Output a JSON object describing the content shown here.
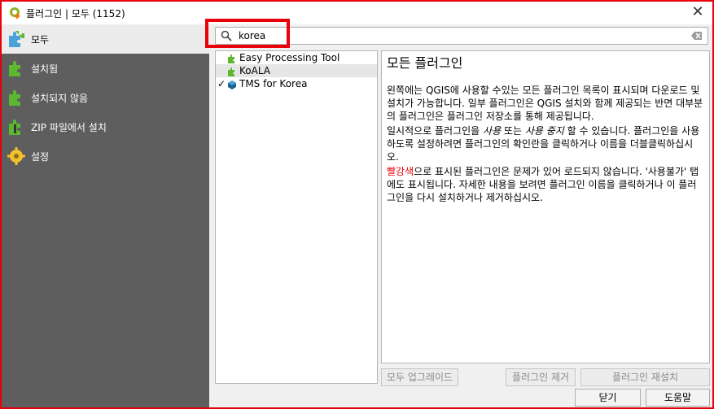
{
  "window": {
    "title": "플러그인 | 모두 (1152)",
    "close_symbol": "✕"
  },
  "sidebar": {
    "items": [
      {
        "label": "모두",
        "icon": "puzzle-all-icon"
      },
      {
        "label": "설치됨",
        "icon": "puzzle-installed-icon"
      },
      {
        "label": "설치되지 않음",
        "icon": "puzzle-not-installed-icon"
      },
      {
        "label": "ZIP 파일에서 설치",
        "icon": "zip-install-icon"
      },
      {
        "label": "설정",
        "icon": "settings-gear-icon"
      }
    ],
    "active_index": 0
  },
  "search": {
    "value": "korea"
  },
  "plugins": [
    {
      "name": "Easy Processing Tool",
      "checked": false,
      "icon": "puzzle-icon"
    },
    {
      "name": "KoALA",
      "checked": false,
      "icon": "puzzle-icon",
      "selected": true
    },
    {
      "name": "TMS for Korea",
      "checked": true,
      "icon": "plugin-3d-icon"
    }
  ],
  "details": {
    "title": "모든 플러그인",
    "p1": "왼쪽에는 QGIS에 사용할 수있는 모든 플러그인 목록이 표시되며 다운로드 및 설치가 가능합니다. 일부 플러그인은 QGIS 설치와 함께 제공되는 반면 대부분의 플러그인은 플러그인 저장소를 통해 제공됩니다.",
    "p2_a": "일시적으로 플러그인을 ",
    "p2_em1": "사용",
    "p2_b": " 또는 ",
    "p2_em2": "사용 중지",
    "p2_c": " 할 수 있습니다. 플러그인을 사용하도록 설정하려면 플러그인의 확인란을 클릭하거나 이름을 더블클릭하십시오.",
    "p3_red": "빨강색",
    "p3_rest": "으로 표시된 플러그인은 문제가 있어 로드되지 않습니다. '사용불가' 탭에도 표시됩니다. 자세한 내용을 보려면 플러그인 이름을 클릭하거나 이 플러그인을 다시 설치하거나 제거하십시오."
  },
  "buttons": {
    "upgrade_all": "모두 업그레이드",
    "uninstall": "플러그인 제거",
    "reinstall": "플러그인 재설치",
    "close": "닫기",
    "help": "도움말"
  },
  "colors": {
    "highlight": "#e8000b",
    "sidebar": "#5e5e5e",
    "puzzle_green": "#5cb82e"
  }
}
